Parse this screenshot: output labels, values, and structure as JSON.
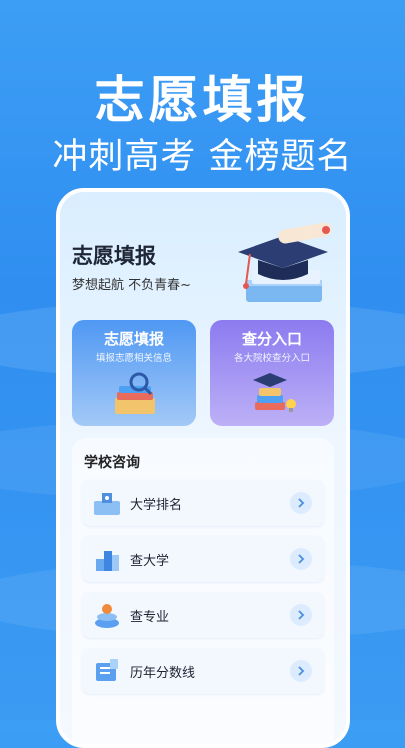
{
  "promo": {
    "headline": "志愿填报",
    "tagline": "冲刺高考 金榜题名"
  },
  "app": {
    "title": "志愿填报",
    "subtitle": "梦想起航 不负青春~"
  },
  "cards": [
    {
      "title": "志愿填报",
      "subtitle": "填报志愿相关信息",
      "icon": "books-magnifier-icon"
    },
    {
      "title": "查分入口",
      "subtitle": "各大院校查分入口",
      "icon": "graduation-cap-books-icon"
    }
  ],
  "consult": {
    "title": "学校咨询",
    "items": [
      {
        "label": "大学排名",
        "icon": "ranking-building-icon"
      },
      {
        "label": "查大学",
        "icon": "university-building-icon"
      },
      {
        "label": "查专业",
        "icon": "major-stack-icon"
      },
      {
        "label": "历年分数线",
        "icon": "score-document-icon"
      }
    ]
  },
  "colors": {
    "background": "#2f8ef0",
    "card_left": "#4f98f3",
    "card_right": "#8b7bf0",
    "chevron": "#4a90e2"
  }
}
